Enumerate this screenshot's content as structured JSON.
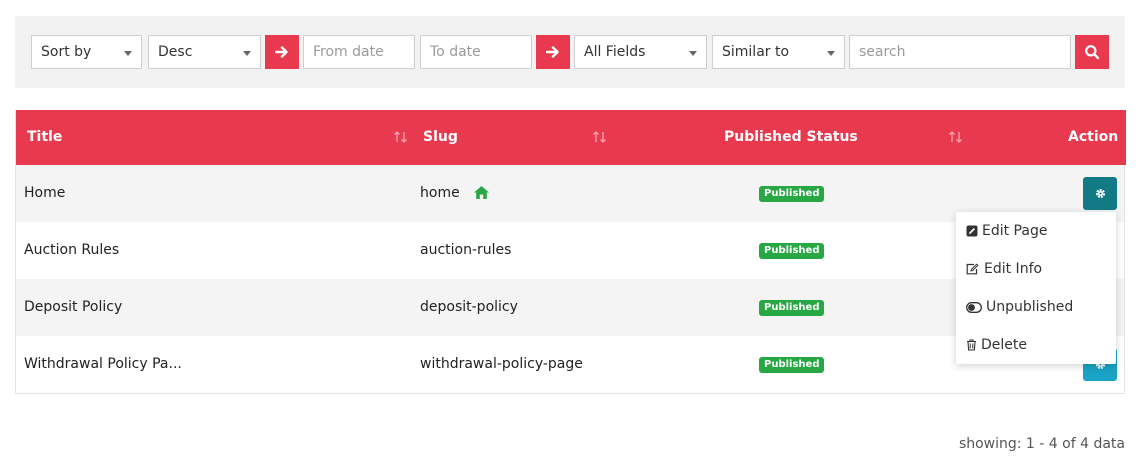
{
  "filters": {
    "sort_by": "Sort by",
    "order": "Desc",
    "from_date_placeholder": "From date",
    "to_date_placeholder": "To date",
    "field": "All Fields",
    "match": "Similar to",
    "search_placeholder": "search"
  },
  "table": {
    "headers": {
      "title": "Title",
      "slug": "Slug",
      "status": "Published Status",
      "action": "Action"
    },
    "rows": [
      {
        "title": "Home",
        "slug": "home",
        "status": "Published"
      },
      {
        "title": "Auction Rules",
        "slug": "auction-rules",
        "status": "Published"
      },
      {
        "title": "Deposit Policy",
        "slug": "deposit-policy",
        "status": "Published"
      },
      {
        "title": "Withdrawal Policy Pa...",
        "slug": "withdrawal-policy-page",
        "status": "Published"
      }
    ]
  },
  "action_menu": {
    "edit_page": "Edit Page",
    "edit_info": "Edit Info",
    "unpublished": "Unpublished",
    "delete": "Delete"
  },
  "footer": {
    "showing": "showing: 1 - 4 of 4 data"
  },
  "colors": {
    "accent": "#e8394f",
    "badge_green": "#28a745",
    "gear_active": "#127a85",
    "gear": "#1aa3c4",
    "home_icon": "#28a745"
  },
  "icons": {
    "arrow": "arrow-right-icon",
    "search": "search-icon",
    "sort": "sort-arrows-icon",
    "home": "home-icon",
    "gear": "gear-icon",
    "edit_page": "edit-square-icon",
    "edit_info": "pencil-square-icon",
    "unpublished": "toggle-icon",
    "delete": "trash-icon"
  }
}
